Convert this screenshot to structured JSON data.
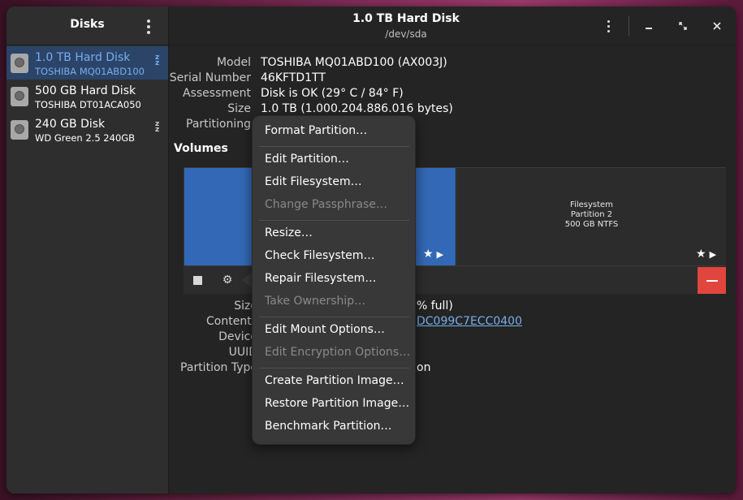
{
  "sidebar": {
    "title": "Disks",
    "disks": [
      {
        "name": "1.0 TB Hard Disk",
        "model": "TOSHIBA MQ01ABD100",
        "sleeping": true,
        "selected": true
      },
      {
        "name": "500 GB Hard Disk",
        "model": "TOSHIBA DT01ACA050",
        "sleeping": false,
        "selected": false
      },
      {
        "name": "240 GB Disk",
        "model": "WD Green 2.5 240GB",
        "sleeping": true,
        "selected": false
      }
    ],
    "sleep_icon_text": "zzz"
  },
  "header": {
    "title": "1.0 TB Hard Disk",
    "subtitle": "/dev/sda"
  },
  "disk_info": {
    "model_label": "Model",
    "model_value": "TOSHIBA MQ01ABD100 (AX003J)",
    "serial_label": "Serial Number",
    "serial_value": "46KFTD1TT",
    "assessment_label": "Assessment",
    "assessment_value": "Disk is OK (29° C / 84° F)",
    "size_label": "Size",
    "size_value": "1.0 TB (1.000.204.886.016 bytes)",
    "partitioning_label": "Partitioning"
  },
  "volumes": {
    "title": "Volumes",
    "partition2": {
      "line1": "Filesystem",
      "line2": "Partition 2",
      "line3": "500 GB NTFS"
    },
    "details": {
      "size_label": "Size",
      "size_value_fragment": "% full)",
      "contents_label": "Contents",
      "contents_value_fragment": "DC099C7ECC0400",
      "device_label": "Device",
      "uuid_label": "UUID",
      "partition_type_label": "Partition Type",
      "partition_type_fragment": "on"
    }
  },
  "context_menu": {
    "items": [
      {
        "label": "Format Partition…",
        "enabled": true
      },
      {
        "label": "Edit Partition…",
        "enabled": true
      },
      {
        "label": "Edit Filesystem…",
        "enabled": true
      },
      {
        "label": "Change Passphrase…",
        "enabled": false
      },
      {
        "label": "Resize…",
        "enabled": true
      },
      {
        "label": "Check Filesystem…",
        "enabled": true
      },
      {
        "label": "Repair Filesystem…",
        "enabled": true
      },
      {
        "label": "Take Ownership…",
        "enabled": false
      },
      {
        "label": "Edit Mount Options…",
        "enabled": true
      },
      {
        "label": "Edit Encryption Options…",
        "enabled": false
      },
      {
        "label": "Create Partition Image…",
        "enabled": true
      },
      {
        "label": "Restore Partition Image…",
        "enabled": true
      },
      {
        "label": "Benchmark Partition…",
        "enabled": true
      }
    ]
  },
  "colors": {
    "accent": "#78aeed",
    "selected_row": "#2b4468",
    "partition_blue": "#3268b5",
    "destructive": "#e0463d",
    "window_bg": "#242424"
  },
  "icons": {
    "disk": "hard-disk-icon",
    "sleep": "sleep-icon",
    "menu": "kebab-menu-icon",
    "minimize": "minimize-icon",
    "maximize": "maximize-icon",
    "close": "close-icon",
    "stop": "stop-icon",
    "settings": "gear-icon",
    "star": "star-icon",
    "play": "play-icon",
    "delete": "minus-icon"
  }
}
